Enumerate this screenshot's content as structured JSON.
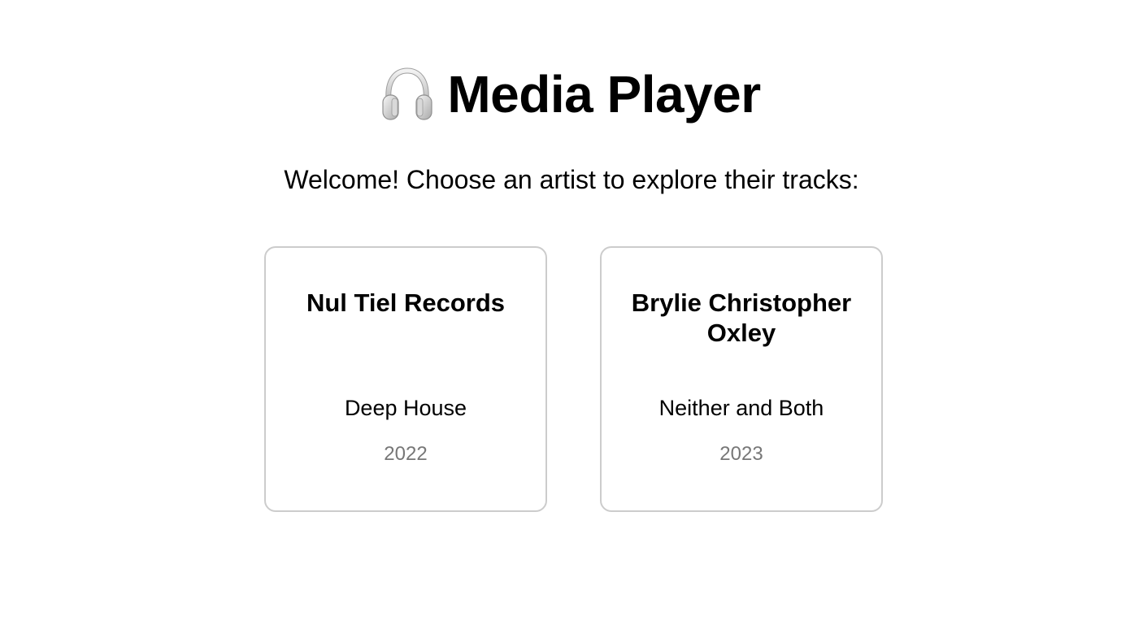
{
  "header": {
    "icon": "headphones-icon",
    "title": "Media Player"
  },
  "subtitle": "Welcome! Choose an artist to explore their tracks:",
  "artists": [
    {
      "name": "Nul Tiel Records",
      "album": "Deep House",
      "year": "2022"
    },
    {
      "name": "Brylie Christopher Oxley",
      "album": "Neither and Both",
      "year": "2023"
    }
  ],
  "colors": {
    "background": "#ffffff",
    "text": "#000000",
    "year_text": "#777777",
    "card_border": "#cccccc"
  }
}
